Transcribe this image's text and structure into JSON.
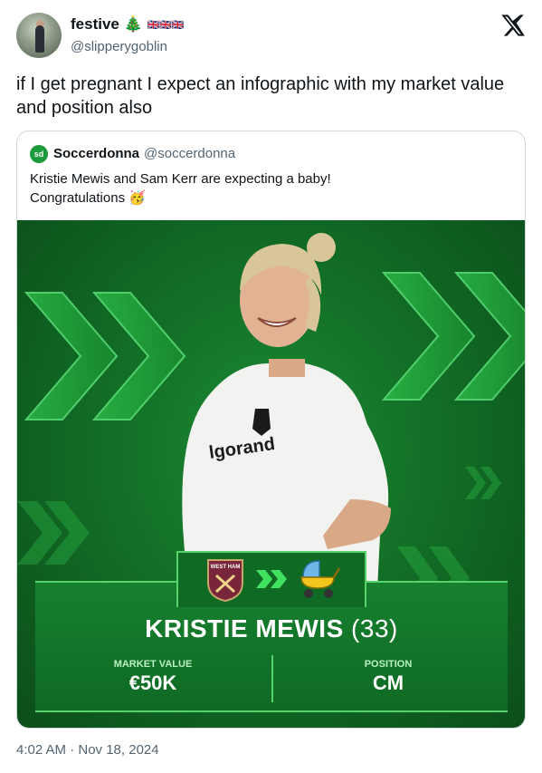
{
  "author": {
    "display_name": "festive 🎄",
    "emoji_strip": "🇬🇧🇬🇧🇬🇧",
    "handle": "@slipperygoblin",
    "avatar_icon": "profile-photo"
  },
  "tweet": {
    "text": "if I get pregnant I expect an infographic with my market value and position also",
    "timestamp": "4:02 AM · Nov 18, 2024"
  },
  "quoted": {
    "logo_text": "sd",
    "display_name": "Soccerdonna",
    "handle": "@soccerdonna",
    "text_line1": "Kristie Mewis and Sam Kerr are expecting a baby!",
    "text_line2": "Congratulations 🥳"
  },
  "graphic": {
    "player_name": "KRISTIE MEWIS",
    "player_age": "(33)",
    "jersey_sponsor": "lgorand",
    "crest_text": "WEST HAM",
    "market_value_label": "MARKET VALUE",
    "market_value": "€50K",
    "position_label": "POSITION",
    "position": "CM",
    "colors": {
      "bg": "#137227",
      "accent": "#57d36b",
      "panel": "#0f6a24"
    }
  }
}
